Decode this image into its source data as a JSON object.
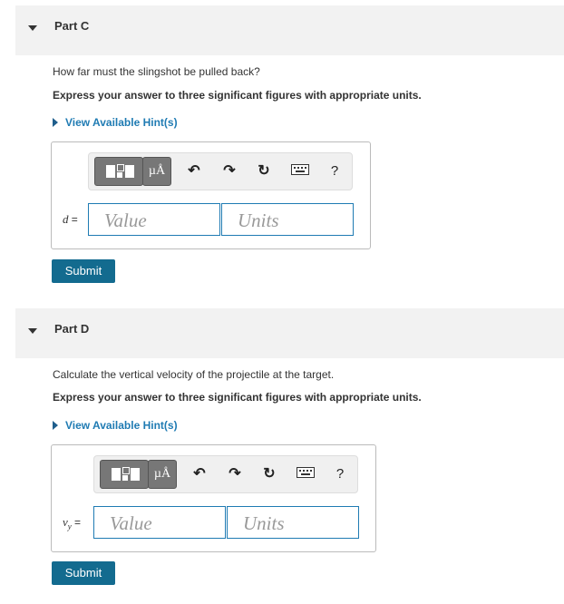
{
  "parts": [
    {
      "title": "Part C",
      "question": "How far must the slingshot be pulled back?",
      "instruction": "Express your answer to three significant figures with appropriate units.",
      "hint": "View Available Hint(s)",
      "var_label": "d",
      "eq": "=",
      "value_placeholder": "Value",
      "units_placeholder": "Units",
      "submit": "Submit"
    },
    {
      "title": "Part D",
      "question": "Calculate the vertical velocity of the projectile at the target.",
      "instruction": "Express your answer to three significant figures with appropriate units.",
      "hint": "View Available Hint(s)",
      "var_label": "v",
      "var_sub": "y",
      "eq": "=",
      "value_placeholder": "Value",
      "units_placeholder": "Units",
      "submit": "Submit"
    }
  ],
  "toolbar": {
    "units_symbol": "µÅ",
    "undo_icon": "undo-icon",
    "redo_icon": "redo-icon",
    "reset_icon": "reset-icon",
    "keyboard_icon": "keyboard-icon",
    "help": "?"
  },
  "colors": {
    "accent": "#1f7bb3",
    "submit": "#136b8f",
    "header_bg": "#f2f2f2"
  }
}
